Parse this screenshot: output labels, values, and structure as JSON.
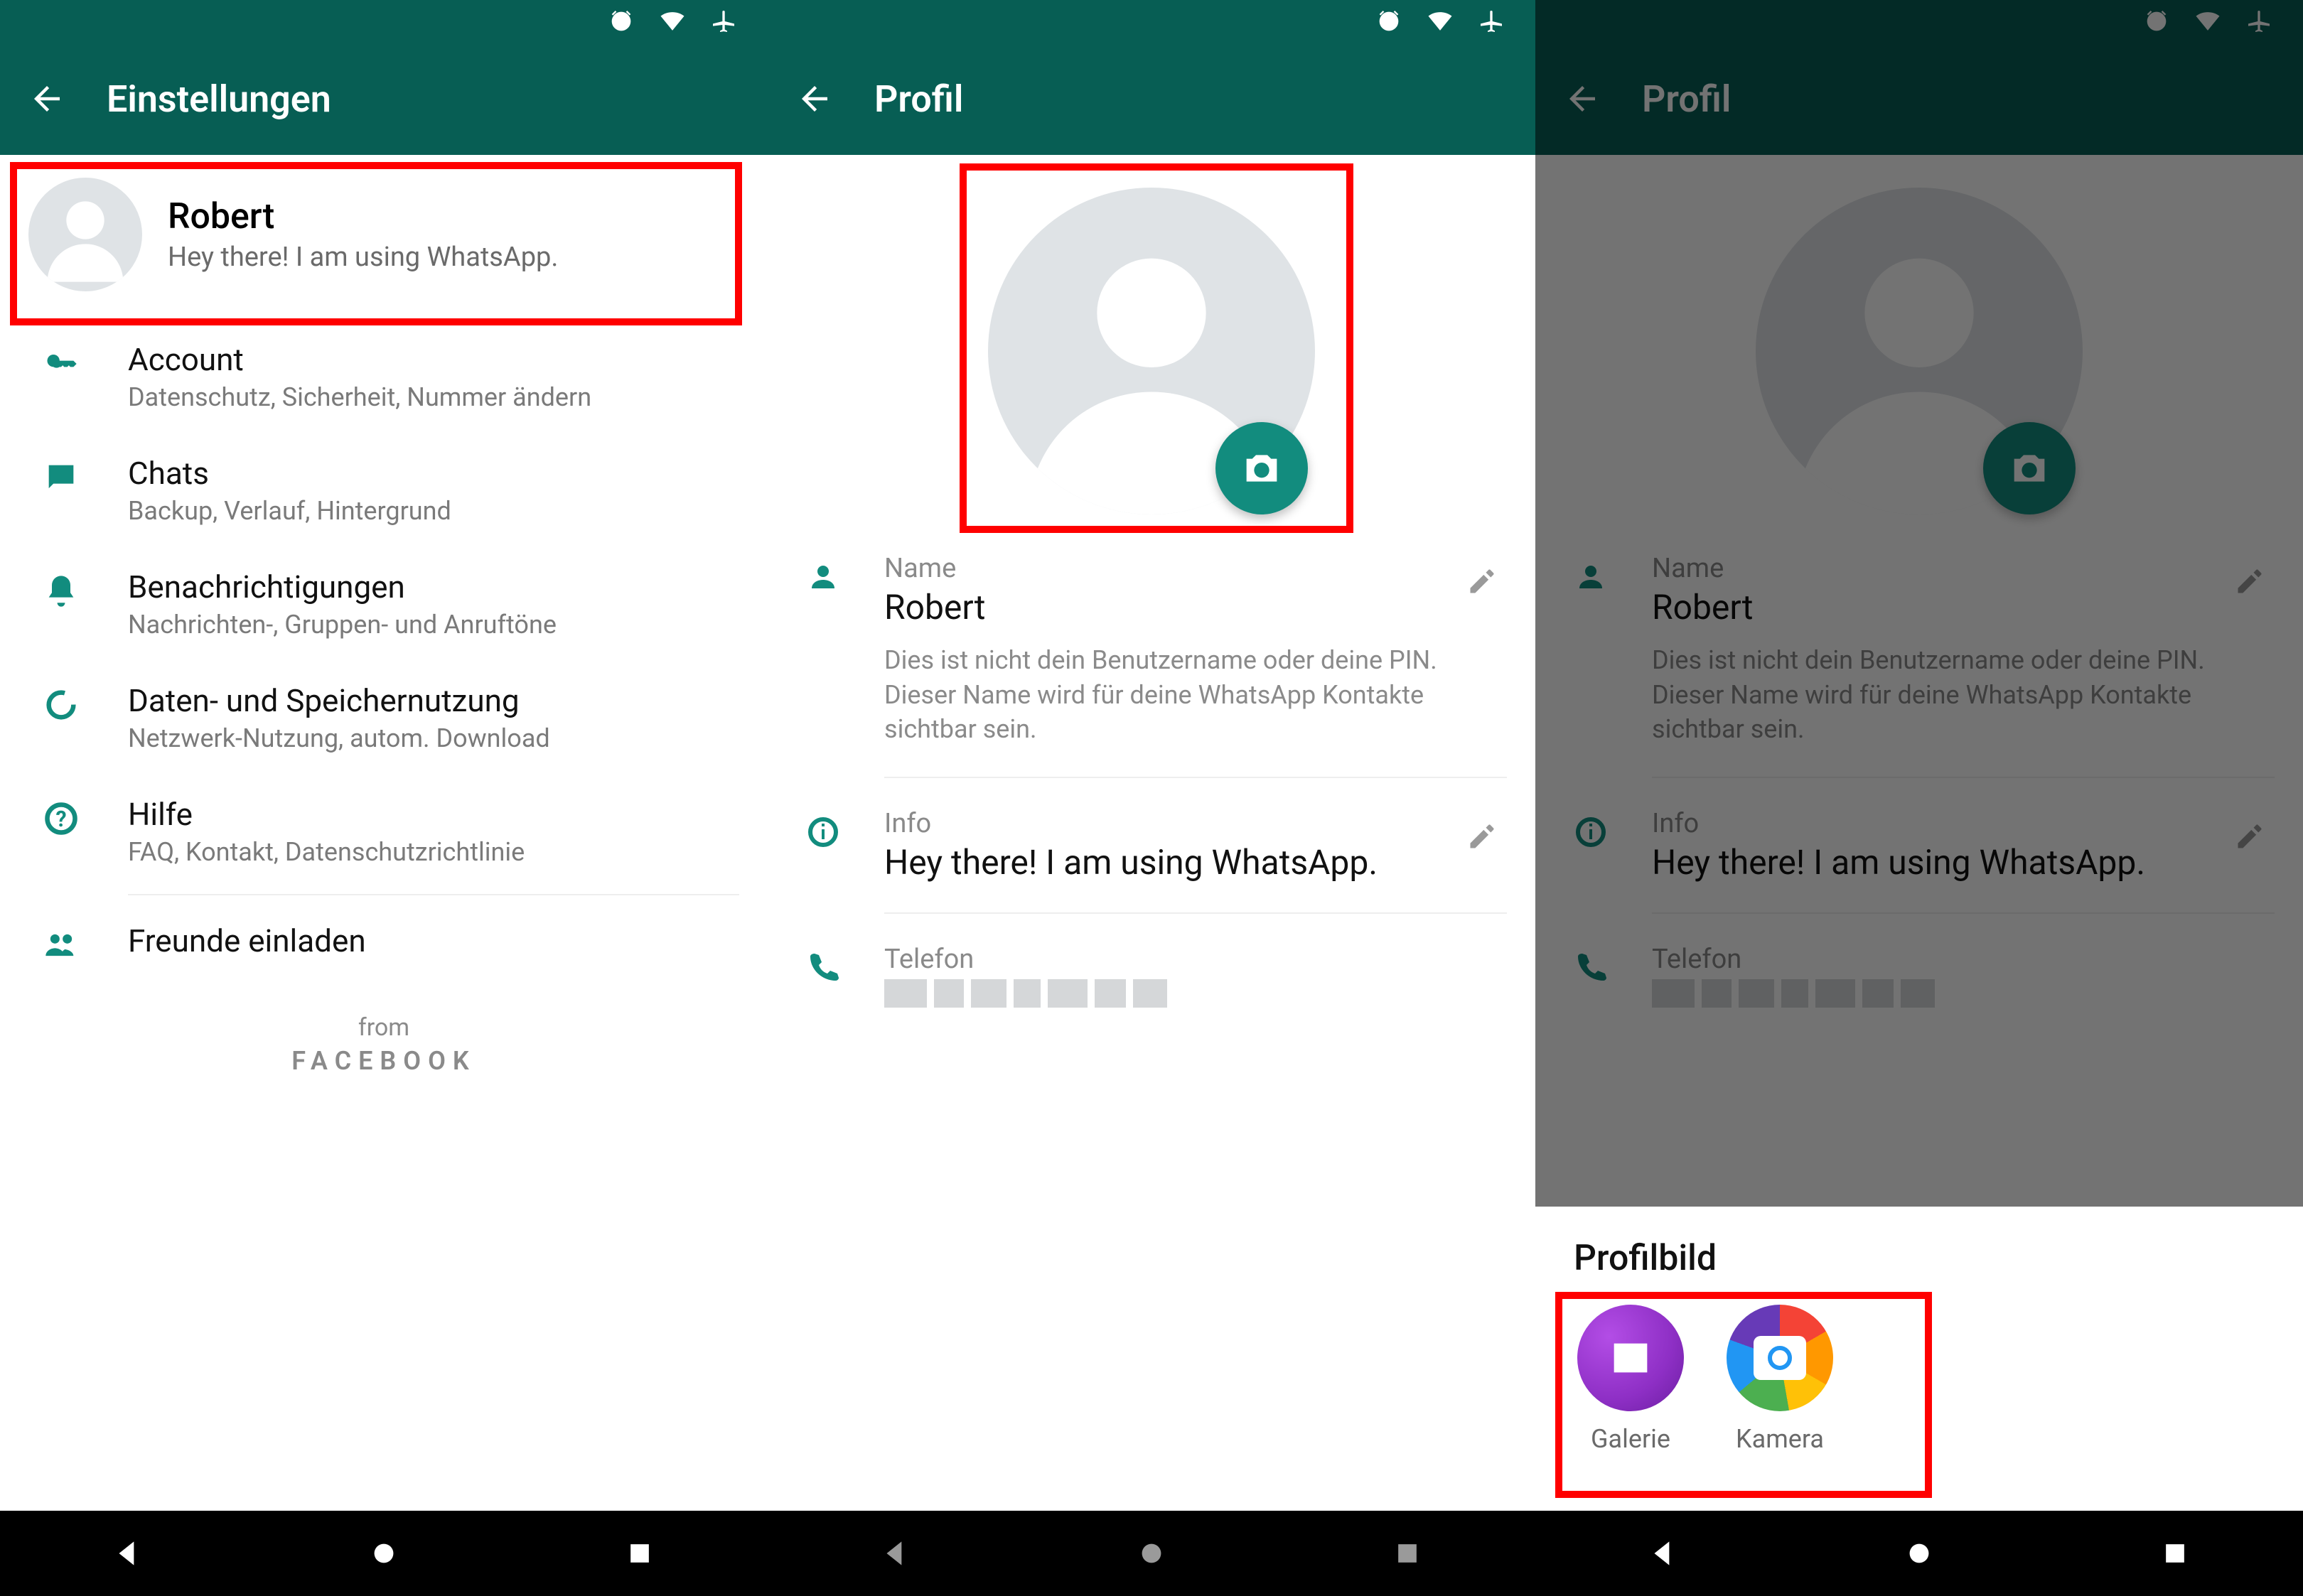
{
  "status_icons": [
    "alarm",
    "wifi",
    "airplane"
  ],
  "screen1": {
    "appbar_title": "Einstellungen",
    "profile": {
      "name": "Robert",
      "status": "Hey there! I am using WhatsApp."
    },
    "items": [
      {
        "icon": "key",
        "title": "Account",
        "subtitle": "Datenschutz, Sicherheit, Nummer ändern"
      },
      {
        "icon": "chat",
        "title": "Chats",
        "subtitle": "Backup, Verlauf, Hintergrund"
      },
      {
        "icon": "bell",
        "title": "Benachrichtigungen",
        "subtitle": "Nachrichten-, Gruppen- und Anruftöne"
      },
      {
        "icon": "data",
        "title": "Daten- und Speichernutzung",
        "subtitle": "Netzwerk-Nutzung, autom. Download"
      },
      {
        "icon": "help",
        "title": "Hilfe",
        "subtitle": "FAQ, Kontakt, Datenschutzrichtlinie"
      },
      {
        "icon": "people",
        "title": "Freunde einladen",
        "subtitle": ""
      }
    ],
    "from_label": "from",
    "from_brand": "FACEBOOK"
  },
  "screen2": {
    "appbar_title": "Profil",
    "name_label": "Name",
    "name_value": "Robert",
    "name_hint": "Dies ist nicht dein Benutzername oder deine PIN. Dieser Name wird für deine WhatsApp Kontakte sichtbar sein.",
    "info_label": "Info",
    "info_value": "Hey there! I am using WhatsApp.",
    "phone_label": "Telefon"
  },
  "screen3": {
    "appbar_title": "Profil",
    "name_label": "Name",
    "name_value": "Robert",
    "name_hint": "Dies ist nicht dein Benutzername oder deine PIN. Dieser Name wird für deine WhatsApp Kontakte sichtbar sein.",
    "info_label": "Info",
    "info_value": "Hey there! I am using WhatsApp.",
    "phone_label": "Telefon",
    "sheet_title": "Profilbild",
    "sheet_options": [
      {
        "key": "gallery",
        "label": "Galerie"
      },
      {
        "key": "camera",
        "label": "Kamera"
      }
    ]
  }
}
